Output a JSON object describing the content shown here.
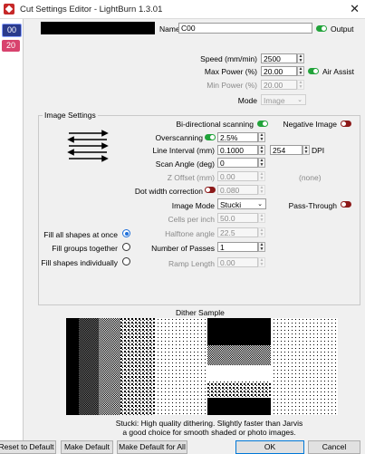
{
  "window": {
    "title": "Cut Settings Editor - LightBurn 1.3.01",
    "close_glyph": "✕"
  },
  "layers": [
    "00",
    "20"
  ],
  "top": {
    "name_label": "Name",
    "name_value": "C00",
    "output_label": "Output"
  },
  "speed": {
    "label": "Speed (mm/min)",
    "value": "2500"
  },
  "max_power": {
    "label": "Max Power (%)",
    "value": "20.00",
    "air_assist_label": "Air Assist"
  },
  "min_power": {
    "label": "Min Power (%)",
    "value": "20.00"
  },
  "mode": {
    "label": "Mode",
    "value": "Image"
  },
  "image_settings": {
    "title": "Image Settings",
    "bidirectional_label": "Bi-directional scanning",
    "negative_label": "Negative Image",
    "overscanning_label": "Overscanning",
    "overscanning_value": "2.5%",
    "line_interval_label": "Line Interval (mm)",
    "line_interval_value": "0.1000",
    "dpi_value": "254",
    "dpi_label": "DPI",
    "scan_angle_label": "Scan Angle (deg)",
    "scan_angle_value": "0",
    "z_offset_label": "Z Offset (mm)",
    "z_offset_value": "0.00",
    "z_offset_none": "(none)",
    "dot_width_label": "Dot width correction",
    "dot_width_value": "0.080",
    "image_mode_label": "Image Mode",
    "image_mode_value": "Stucki",
    "pass_through_label": "Pass-Through",
    "cells_label": "Cells per inch",
    "cells_value": "50.0",
    "halftone_label": "Halftone angle",
    "halftone_value": "22.5",
    "passes_label": "Number of Passes",
    "passes_value": "1",
    "ramp_label": "Ramp Length",
    "ramp_value": "0.00",
    "fill_options": [
      "Fill all shapes at once",
      "Fill groups together",
      "Fill shapes individually"
    ]
  },
  "dither": {
    "title": "Dither Sample",
    "description_line1": "Stucki: High quality dithering. Slightly faster than Jarvis",
    "description_line2": "a good choice for smooth shaded or photo images."
  },
  "buttons": {
    "reset": "Reset to Default",
    "make_default": "Make Default",
    "make_default_all": "Make Default for All",
    "ok": "OK",
    "cancel": "Cancel"
  },
  "colors": {
    "toggle_on": "#21a33a",
    "toggle_off": "#8c1a1a",
    "layer0": "#2a3a8c",
    "layer1": "#d8436e",
    "radio_selected": "#1e6fd9"
  }
}
